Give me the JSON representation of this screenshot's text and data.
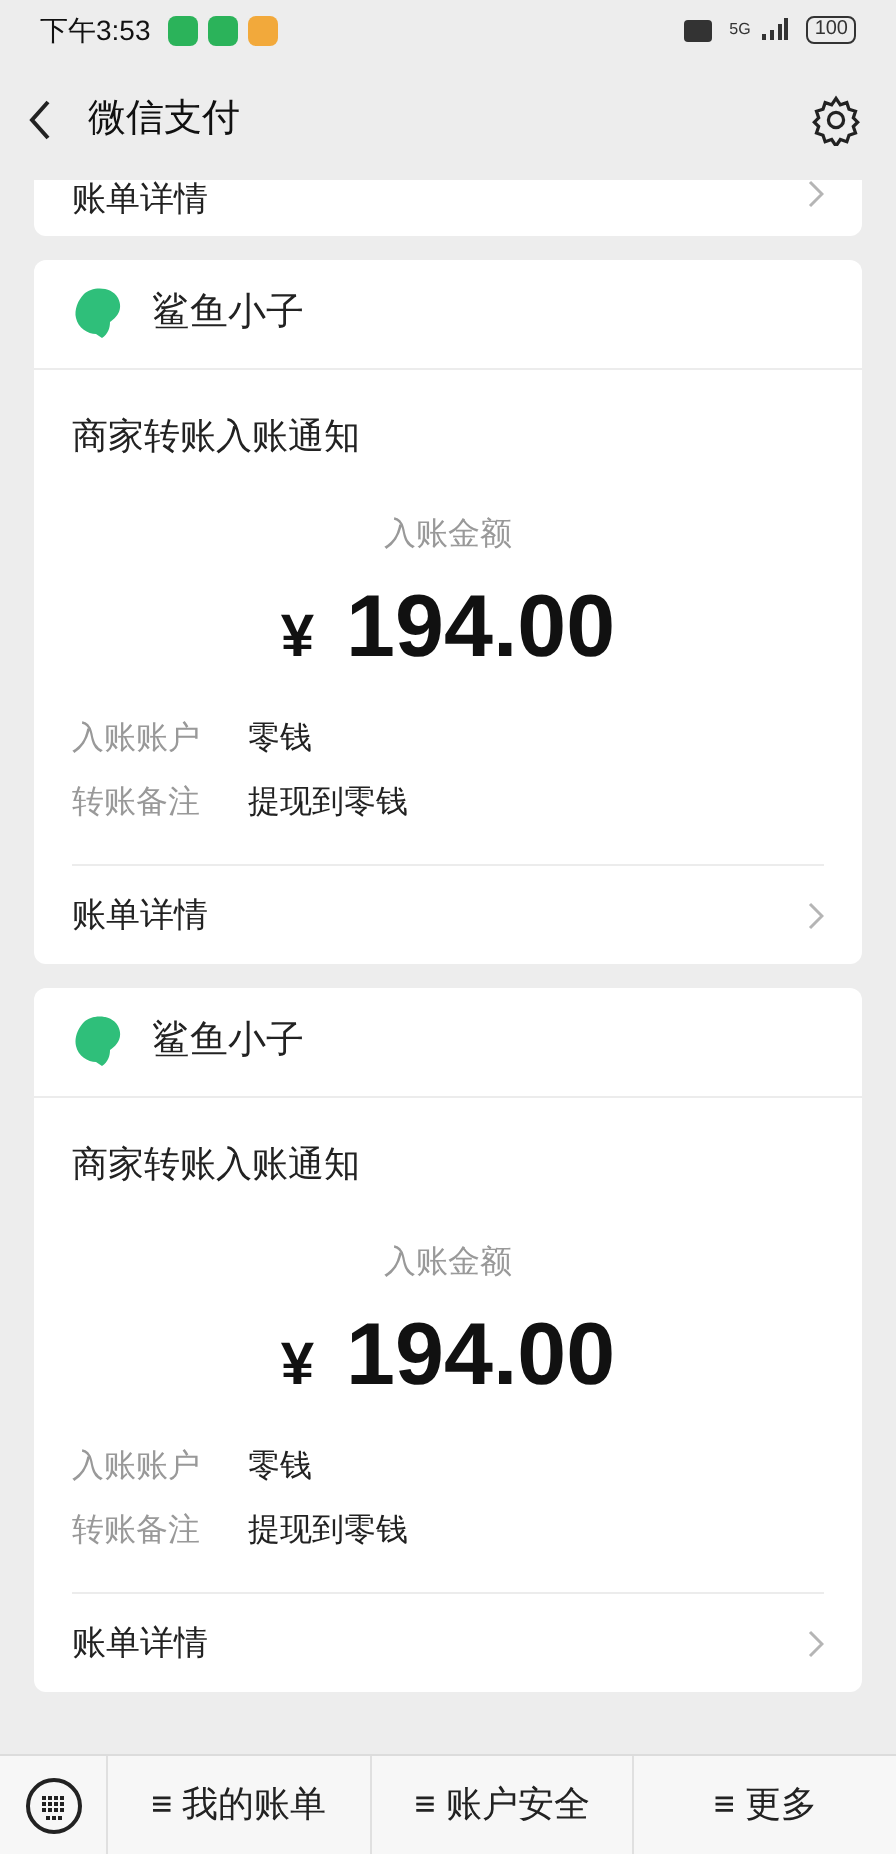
{
  "status_bar": {
    "time": "下午3:53",
    "notifications": [
      {
        "color": "#2bb35a"
      },
      {
        "color": "#2bb35a"
      },
      {
        "color": "#f2a93b"
      }
    ],
    "network": "5G",
    "battery": "100"
  },
  "header": {
    "title": "微信支付"
  },
  "partial_card": {
    "link": "账单详情"
  },
  "cards": [
    {
      "sender": "鲨鱼小子",
      "title": "商家转账入账通知",
      "amount_label": "入账金额",
      "currency": "¥",
      "amount": "194.00",
      "fields": [
        {
          "label": "入账账户",
          "value": "零钱"
        },
        {
          "label": "转账备注",
          "value": "提现到零钱"
        }
      ],
      "link": "账单详情"
    },
    {
      "sender": "鲨鱼小子",
      "title": "商家转账入账通知",
      "amount_label": "入账金额",
      "currency": "¥",
      "amount": "194.00",
      "fields": [
        {
          "label": "入账账户",
          "value": "零钱"
        },
        {
          "label": "转账备注",
          "value": "提现到零钱"
        }
      ],
      "link": "账单详情"
    }
  ],
  "bottom_menu": [
    "≡ 我的账单",
    "≡ 账户安全",
    "≡ 更多"
  ]
}
